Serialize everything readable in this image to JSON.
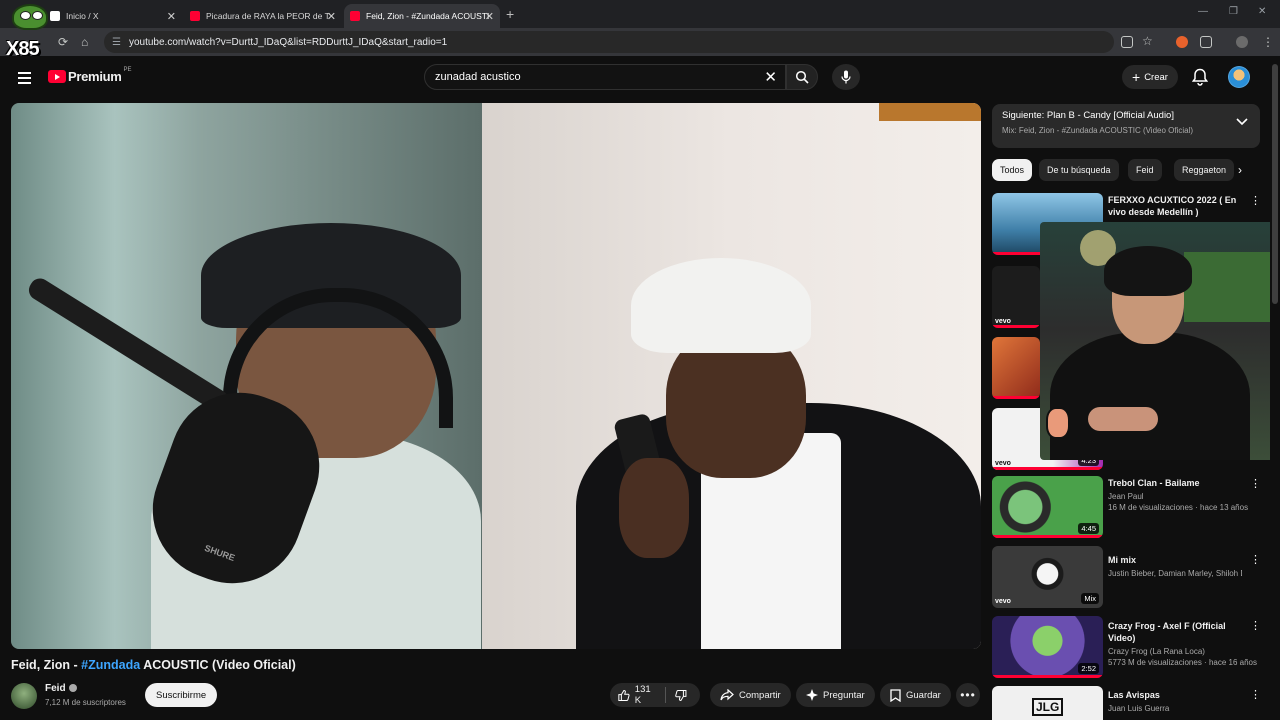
{
  "browser": {
    "tabs": [
      {
        "title": "Inicio / X"
      },
      {
        "title": "Picadura de RAYA la PEOR de T"
      },
      {
        "title": "Feid, Zion - #Zundada ACOUSTI"
      }
    ],
    "url": "youtube.com/watch?v=DurttJ_IDaQ&list=RDDurttJ_IDaQ&start_radio=1",
    "streamer_overlay_text": "X85"
  },
  "youtube": {
    "brand": "Premium",
    "region": "PE",
    "search_value": "zunadad acustico",
    "create_label": "Crear"
  },
  "video": {
    "title_prefix": "Feid, Zion - ",
    "title_tag": "#Zundada",
    "title_suffix": " ACOUSTIC (Video Oficial)",
    "mic_brand": "SHURE",
    "channel": "Feid",
    "subscribers": "7,12 M de suscriptores",
    "subscribe_label": "Suscribirme",
    "likes": "131 K",
    "share_label": "Compartir",
    "ask_label": "Preguntar",
    "save_label": "Guardar"
  },
  "next_up": {
    "title": "Siguiente: Plan B - Candy [Official Audio]",
    "subtitle": "Mix: Feid, Zion - #Zundada ACOUSTIC (Video Oficial)"
  },
  "chips": [
    "Todos",
    "De tu búsqueda",
    "Feid",
    "Reggaeton"
  ],
  "recommendations": [
    {
      "title": "FERXXO ACUXTICO 2022 ( En vivo desde Medellín )",
      "channel": "",
      "views": "",
      "duration": "",
      "thumb_color": "#5a9bc4"
    },
    {
      "title": "",
      "channel": "",
      "views": "",
      "duration": "",
      "thumb_color": "#1c1c1c"
    },
    {
      "title": "",
      "channel": "",
      "views": "",
      "duration": "",
      "thumb_color": "#c14a2a"
    },
    {
      "title": "",
      "channel": "",
      "views": "",
      "duration": "4:23",
      "thumb_color": "#e8e8e8"
    },
    {
      "title": "Trebol Clan - Bailame",
      "channel": "Jean Paul",
      "views": "16 M de visualizaciones · hace 13 años",
      "duration": "4:45",
      "thumb_color": "#3c7a3c"
    },
    {
      "title": "Mi mix",
      "channel": "Justin Bieber, Damian Marley, Shiloh Dyn...",
      "views": "",
      "duration": "Mix",
      "thumb_color": "#2a2a2a"
    },
    {
      "title": "Crazy Frog - Axel F (Official Video)",
      "channel": "Crazy Frog (La Rana Loca)",
      "views": "5773 M de visualizaciones · hace 16 años",
      "duration": "2:52",
      "thumb_color": "#6a4fb0"
    },
    {
      "title": "Las Avispas",
      "channel": "Juan Luis Guerra",
      "views": "",
      "duration": "",
      "thumb_color": "#f0f0f0"
    }
  ],
  "colors": {
    "accent": "#ff0033",
    "link": "#3ea6ff",
    "bg": "#0f0f0f"
  }
}
